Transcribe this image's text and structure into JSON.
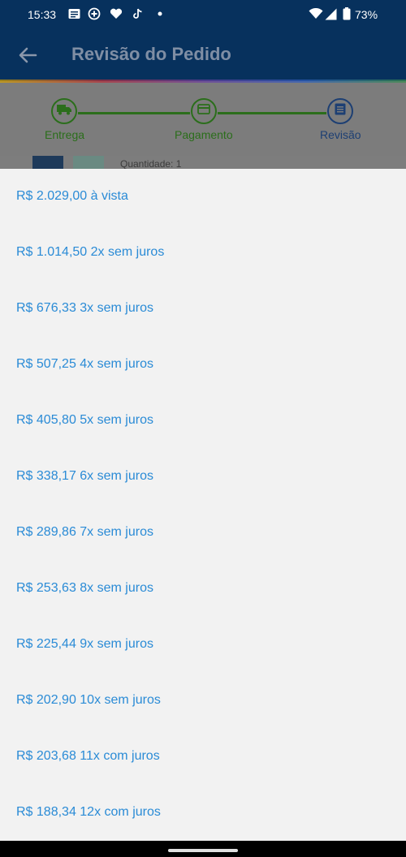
{
  "status_bar": {
    "time": "15:33",
    "battery": "73%",
    "icons": [
      "news-icon",
      "add-circle-icon",
      "heart-icon",
      "tiktok-icon",
      "dot-icon",
      "wifi-icon",
      "signal-icon",
      "battery-icon"
    ]
  },
  "app_bar": {
    "back_icon": "arrow-left-icon",
    "title": "Revisão do Pedido"
  },
  "stepper": {
    "steps": [
      {
        "label": "Entrega",
        "icon": "truck-icon"
      },
      {
        "label": "Pagamento",
        "icon": "credit-card-icon"
      },
      {
        "label": "Revisão",
        "icon": "document-icon"
      }
    ],
    "completed_color": "#2b6e1b",
    "active_color": "#1d3f73"
  },
  "behind": {
    "quantity_text": "Quantidade: 1"
  },
  "installments": {
    "accent": "#2a8bd6",
    "options": [
      "R$ 2.029,00 à vista",
      "R$ 1.014,50 2x sem juros",
      "R$ 676,33 3x sem juros",
      "R$ 507,25 4x sem juros",
      "R$ 405,80 5x sem juros",
      "R$ 338,17 6x sem juros",
      "R$ 289,86 7x sem juros",
      "R$ 253,63 8x sem juros",
      "R$ 225,44 9x sem juros",
      "R$ 202,90 10x sem juros",
      "R$ 203,68 11x com juros",
      "R$ 188,34 12x com juros"
    ]
  }
}
